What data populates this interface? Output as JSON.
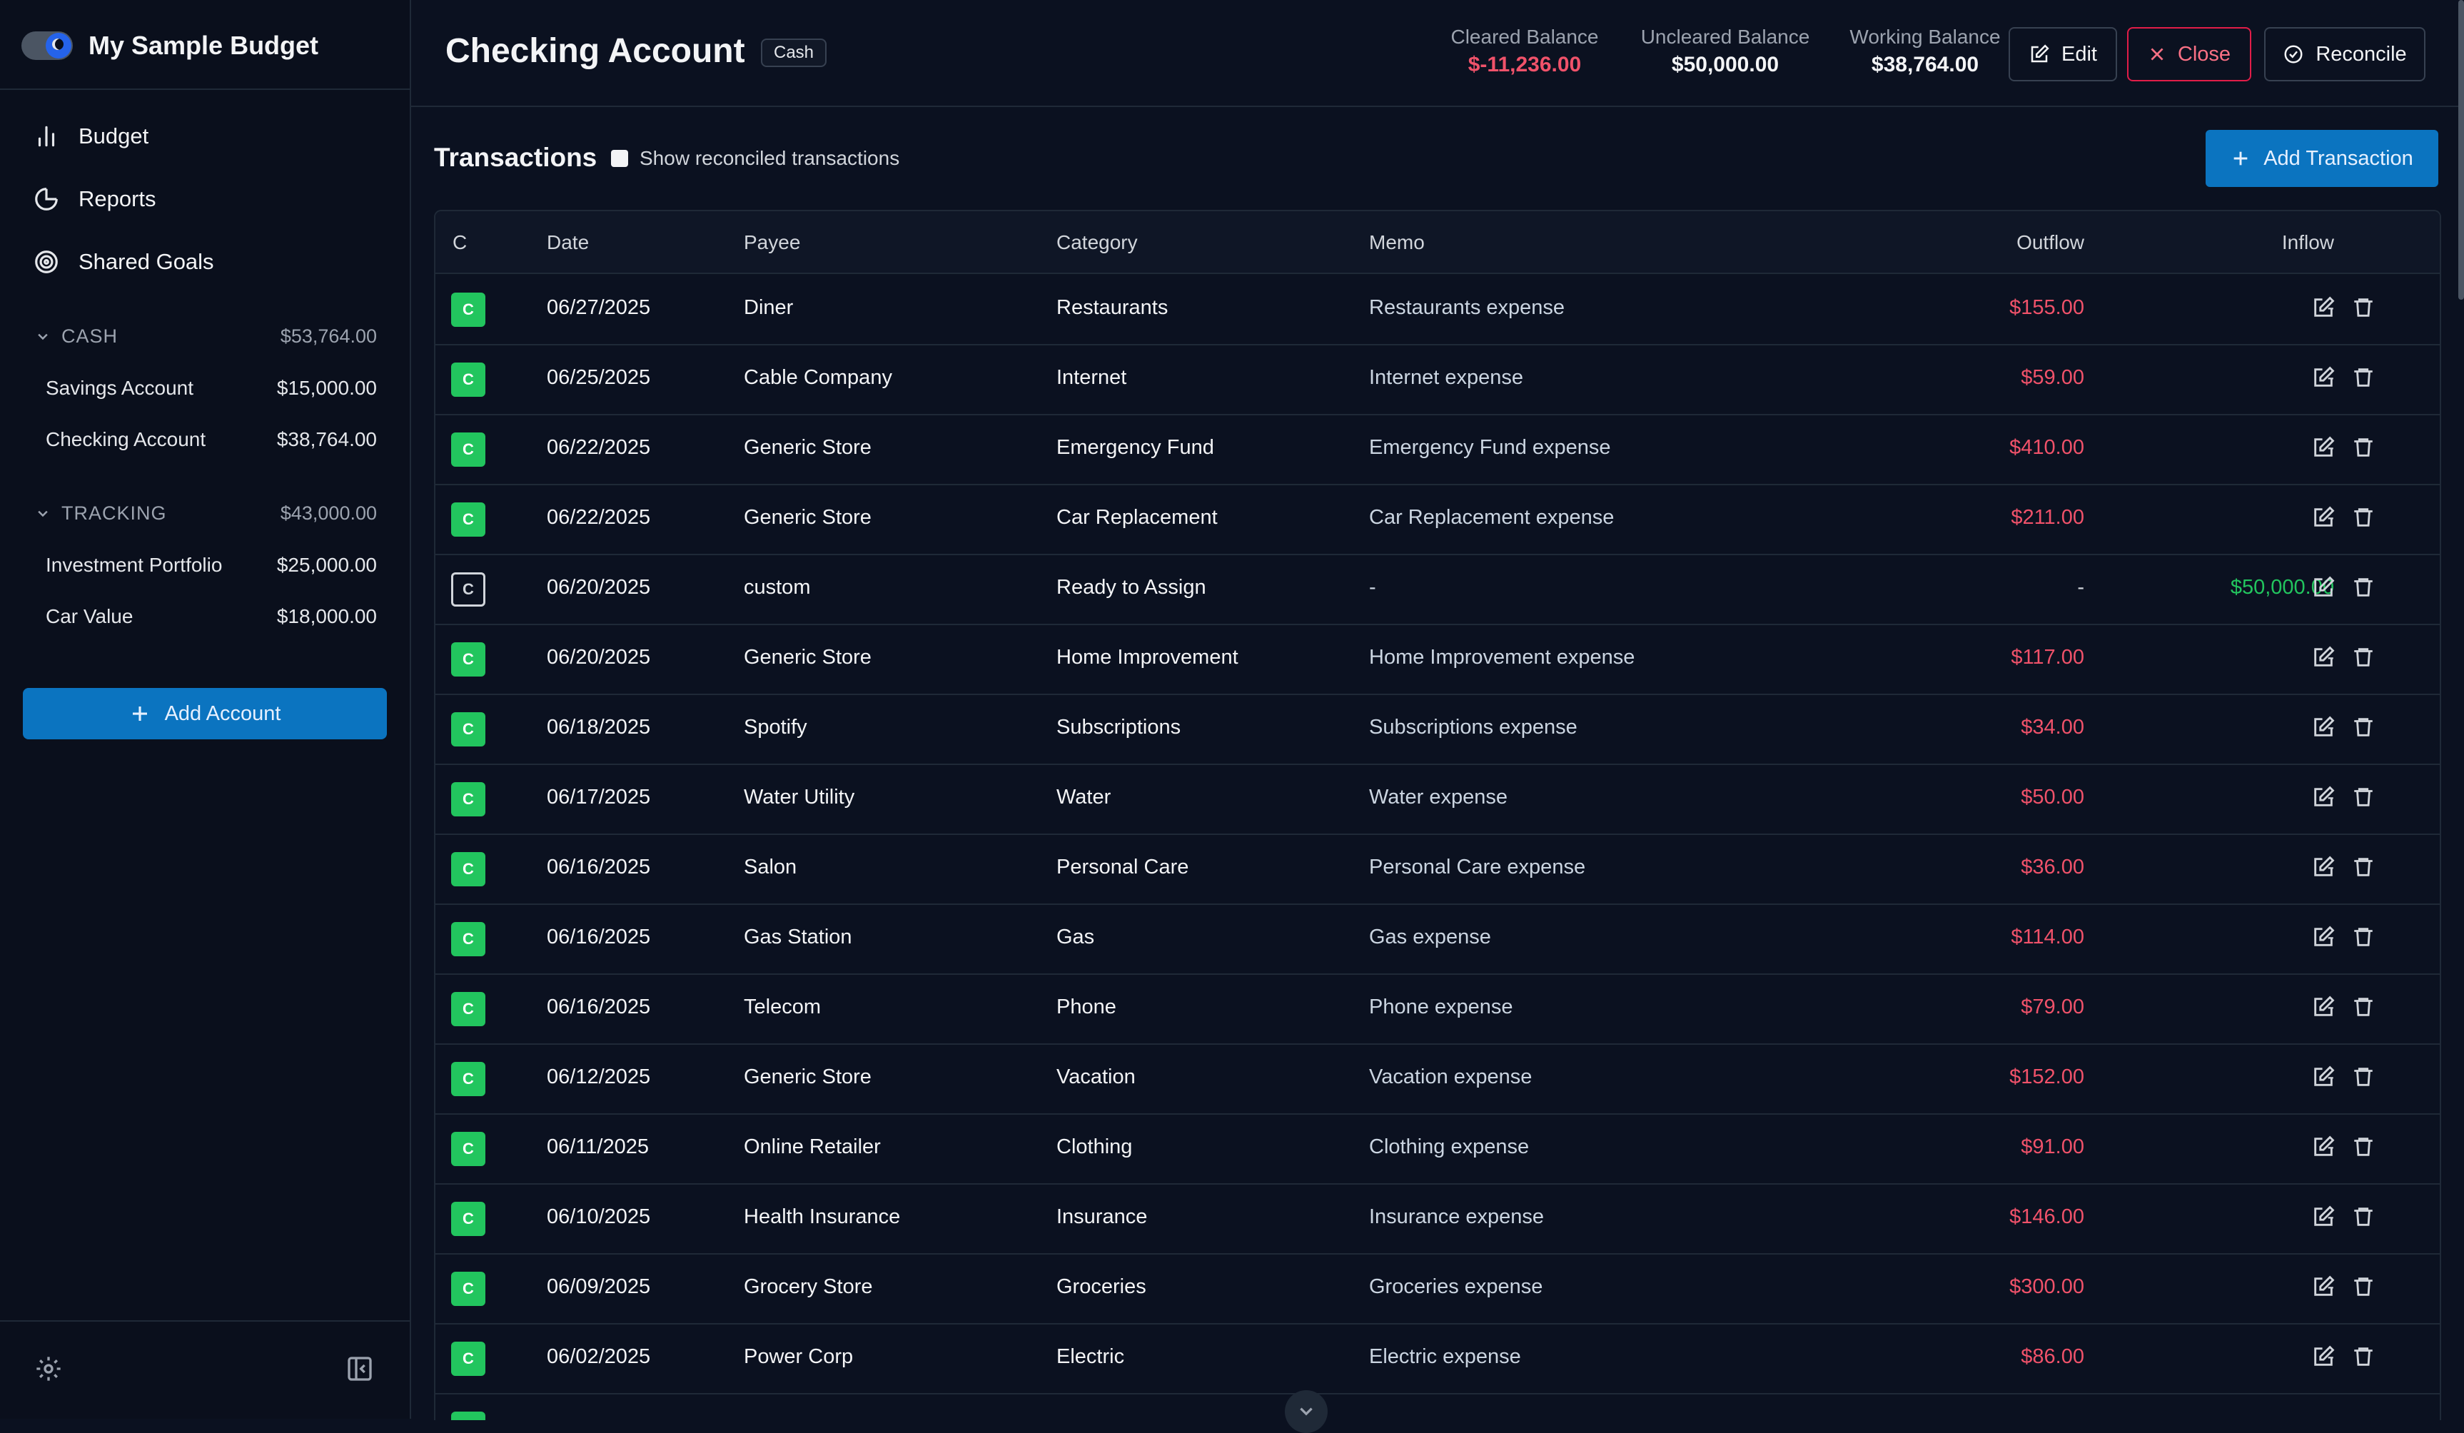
{
  "app": {
    "budget_name": "My Sample Budget"
  },
  "nav": [
    {
      "label": "Budget",
      "icon": "bar-chart-icon"
    },
    {
      "label": "Reports",
      "icon": "pie-chart-icon"
    },
    {
      "label": "Shared Goals",
      "icon": "target-icon"
    }
  ],
  "groups": {
    "cash": {
      "label": "CASH",
      "total": "$53,764.00",
      "accounts": [
        {
          "name": "Savings Account",
          "balance": "$15,000.00"
        },
        {
          "name": "Checking Account",
          "balance": "$38,764.00"
        }
      ]
    },
    "tracking": {
      "label": "TRACKING",
      "total": "$43,000.00",
      "accounts": [
        {
          "name": "Investment Portfolio",
          "balance": "$25,000.00"
        },
        {
          "name": "Car Value",
          "balance": "$18,000.00"
        }
      ]
    }
  },
  "sidebar": {
    "add_account_label": "Add Account"
  },
  "header": {
    "account_title": "Checking Account",
    "account_type_badge": "Cash",
    "cleared": {
      "label": "Cleared Balance",
      "value": "$-11,236.00"
    },
    "uncleared": {
      "label": "Uncleared Balance",
      "value": "$50,000.00"
    },
    "working": {
      "label": "Working Balance",
      "value": "$38,764.00"
    },
    "edit_label": "Edit",
    "close_label": "Close",
    "reconcile_label": "Reconcile"
  },
  "transactions": {
    "title": "Transactions",
    "show_reconciled_label": "Show reconciled transactions",
    "add_label": "Add Transaction",
    "columns": {
      "c": "C",
      "date": "Date",
      "payee": "Payee",
      "category": "Category",
      "memo": "Memo",
      "outflow": "Outflow",
      "inflow": "Inflow"
    },
    "rows": [
      {
        "cleared": true,
        "c": "C",
        "date": "06/27/2025",
        "payee": "Diner",
        "category": "Restaurants",
        "memo": "Restaurants expense",
        "outflow": "$155.00",
        "inflow": "-"
      },
      {
        "cleared": true,
        "c": "C",
        "date": "06/25/2025",
        "payee": "Cable Company",
        "category": "Internet",
        "memo": "Internet expense",
        "outflow": "$59.00",
        "inflow": "-"
      },
      {
        "cleared": true,
        "c": "C",
        "date": "06/22/2025",
        "payee": "Generic Store",
        "category": "Emergency Fund",
        "memo": "Emergency Fund expense",
        "outflow": "$410.00",
        "inflow": "-"
      },
      {
        "cleared": true,
        "c": "C",
        "date": "06/22/2025",
        "payee": "Generic Store",
        "category": "Car Replacement",
        "memo": "Car Replacement expense",
        "outflow": "$211.00",
        "inflow": "-"
      },
      {
        "cleared": false,
        "c": "C",
        "date": "06/20/2025",
        "payee": "custom",
        "category": "Ready to Assign",
        "memo": "-",
        "outflow": "-",
        "inflow": "$50,000.00"
      },
      {
        "cleared": true,
        "c": "C",
        "date": "06/20/2025",
        "payee": "Generic Store",
        "category": "Home Improvement",
        "memo": "Home Improvement expense",
        "outflow": "$117.00",
        "inflow": "-"
      },
      {
        "cleared": true,
        "c": "C",
        "date": "06/18/2025",
        "payee": "Spotify",
        "category": "Subscriptions",
        "memo": "Subscriptions expense",
        "outflow": "$34.00",
        "inflow": "-"
      },
      {
        "cleared": true,
        "c": "C",
        "date": "06/17/2025",
        "payee": "Water Utility",
        "category": "Water",
        "memo": "Water expense",
        "outflow": "$50.00",
        "inflow": "-"
      },
      {
        "cleared": true,
        "c": "C",
        "date": "06/16/2025",
        "payee": "Salon",
        "category": "Personal Care",
        "memo": "Personal Care expense",
        "outflow": "$36.00",
        "inflow": "-"
      },
      {
        "cleared": true,
        "c": "C",
        "date": "06/16/2025",
        "payee": "Gas Station",
        "category": "Gas",
        "memo": "Gas expense",
        "outflow": "$114.00",
        "inflow": "-"
      },
      {
        "cleared": true,
        "c": "C",
        "date": "06/16/2025",
        "payee": "Telecom",
        "category": "Phone",
        "memo": "Phone expense",
        "outflow": "$79.00",
        "inflow": "-"
      },
      {
        "cleared": true,
        "c": "C",
        "date": "06/12/2025",
        "payee": "Generic Store",
        "category": "Vacation",
        "memo": "Vacation expense",
        "outflow": "$152.00",
        "inflow": "-"
      },
      {
        "cleared": true,
        "c": "C",
        "date": "06/11/2025",
        "payee": "Online Retailer",
        "category": "Clothing",
        "memo": "Clothing expense",
        "outflow": "$91.00",
        "inflow": "-"
      },
      {
        "cleared": true,
        "c": "C",
        "date": "06/10/2025",
        "payee": "Health Insurance",
        "category": "Insurance",
        "memo": "Insurance expense",
        "outflow": "$146.00",
        "inflow": "-"
      },
      {
        "cleared": true,
        "c": "C",
        "date": "06/09/2025",
        "payee": "Grocery Store",
        "category": "Groceries",
        "memo": "Groceries expense",
        "outflow": "$300.00",
        "inflow": "-"
      },
      {
        "cleared": true,
        "c": "C",
        "date": "06/02/2025",
        "payee": "Power Corp",
        "category": "Electric",
        "memo": "Electric expense",
        "outflow": "$86.00",
        "inflow": "-"
      }
    ]
  },
  "colors": {
    "accent": "#0b74c0",
    "negative": "#f0526a",
    "positive": "#22c55e",
    "cleared_badge": "#22c55e"
  }
}
